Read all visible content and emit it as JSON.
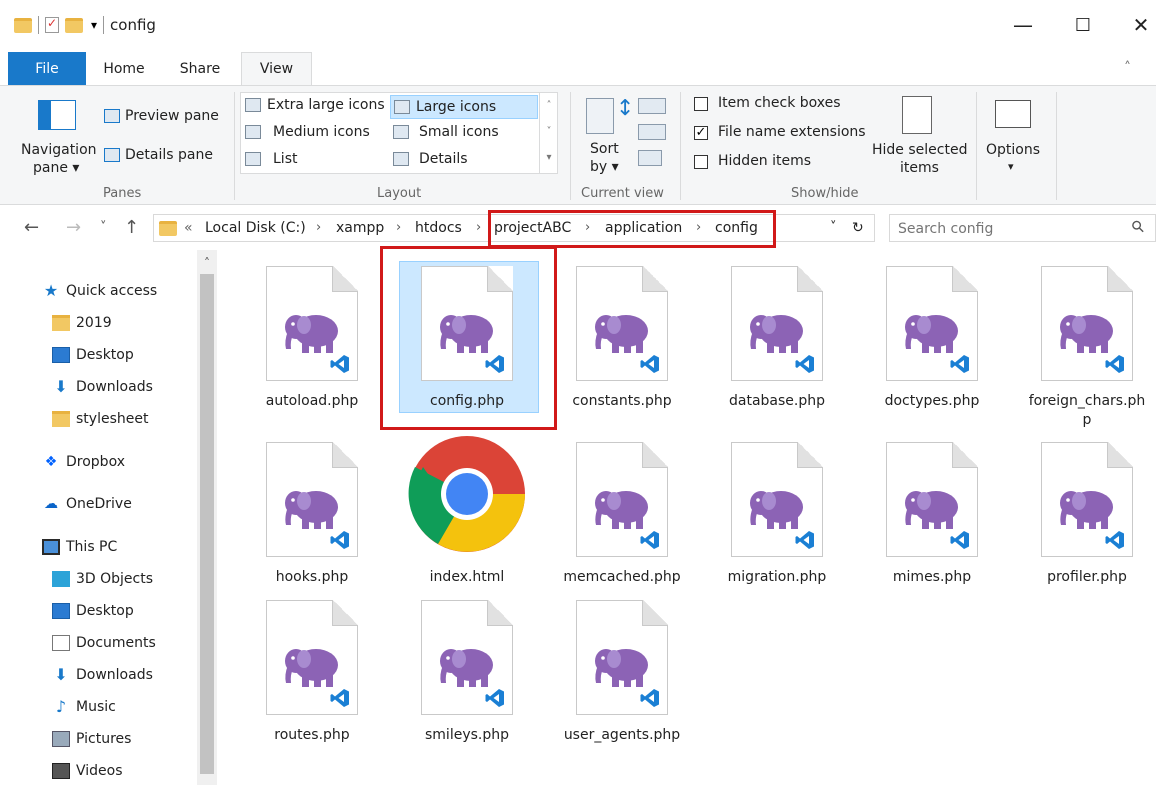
{
  "window": {
    "title": "config",
    "minimize": "—",
    "maximize": "☐",
    "close": "✕"
  },
  "tabs": {
    "file": "File",
    "home": "Home",
    "share": "Share",
    "view": "View"
  },
  "ribbon": {
    "panes": {
      "navigation_pane_1": "Navigation",
      "navigation_pane_2": "pane ▾",
      "preview_pane": "Preview pane",
      "details_pane": "Details pane",
      "group": "Panes"
    },
    "layout": {
      "extra_large": "Extra large icons",
      "large": "Large icons",
      "medium": "Medium icons",
      "small": "Small icons",
      "list": "List",
      "details": "Details",
      "group": "Layout"
    },
    "current_view": {
      "sort_1": "Sort",
      "sort_2": "by ▾",
      "group": "Current view"
    },
    "show_hide": {
      "item_check_boxes": "Item check boxes",
      "file_name_extensions": "File name extensions",
      "hidden_items": "Hidden items",
      "hide_selected_1": "Hide selected",
      "hide_selected_2": "items",
      "group": "Show/hide",
      "item_check_boxes_checked": false,
      "file_name_extensions_checked": true,
      "hidden_items_checked": false
    },
    "options": {
      "label": "Options",
      "arrow": "▾"
    }
  },
  "address": {
    "back": "←",
    "forward": "→",
    "recent": "˅",
    "up": "↑",
    "overflow": "«",
    "crumbs": [
      "Local Disk (C:)",
      "xampp",
      "htdocs",
      "projectABC",
      "application",
      "config"
    ],
    "dropdown": "˅",
    "refresh": "↻",
    "search_placeholder": "Search config",
    "search_icon": "⚲"
  },
  "nav": {
    "items": [
      {
        "label": "Quick access",
        "icon": "star-icon"
      },
      {
        "label": "2019",
        "icon": "folder-icon"
      },
      {
        "label": "Desktop",
        "icon": "desktop-icon"
      },
      {
        "label": "Downloads",
        "icon": "download-icon"
      },
      {
        "label": "stylesheet",
        "icon": "folder-icon"
      },
      {
        "label": "Dropbox",
        "icon": "dropbox-icon"
      },
      {
        "label": "OneDrive",
        "icon": "cloud-icon"
      },
      {
        "label": "This PC",
        "icon": "pc-icon"
      },
      {
        "label": "3D Objects",
        "icon": "cube-icon"
      },
      {
        "label": "Desktop",
        "icon": "desktop-icon"
      },
      {
        "label": "Documents",
        "icon": "document-icon"
      },
      {
        "label": "Downloads",
        "icon": "download-icon"
      },
      {
        "label": "Music",
        "icon": "music-icon"
      },
      {
        "label": "Pictures",
        "icon": "pictures-icon"
      },
      {
        "label": "Videos",
        "icon": "video-icon"
      }
    ],
    "scroll_up": "˄"
  },
  "files": [
    {
      "name": "autoload.php",
      "type": "php"
    },
    {
      "name": "config.php",
      "type": "php",
      "selected": true
    },
    {
      "name": "constants.php",
      "type": "php"
    },
    {
      "name": "database.php",
      "type": "php"
    },
    {
      "name": "doctypes.php",
      "type": "php"
    },
    {
      "name": "foreign_chars.ph",
      "name2": "p",
      "type": "php"
    },
    {
      "name": "hooks.php",
      "type": "php"
    },
    {
      "name": "index.html",
      "type": "chrome"
    },
    {
      "name": "memcached.php",
      "type": "php"
    },
    {
      "name": "migration.php",
      "type": "php"
    },
    {
      "name": "mimes.php",
      "type": "php"
    },
    {
      "name": "profiler.php",
      "type": "php"
    },
    {
      "name": "routes.php",
      "type": "php"
    },
    {
      "name": "smileys.php",
      "type": "php"
    },
    {
      "name": "user_agents.php",
      "type": "php"
    }
  ],
  "colors": {
    "accent": "#1979ca",
    "highlight": "#d11919",
    "php_elephant": "#8c63b5",
    "vscode": "#1a7fd4"
  }
}
